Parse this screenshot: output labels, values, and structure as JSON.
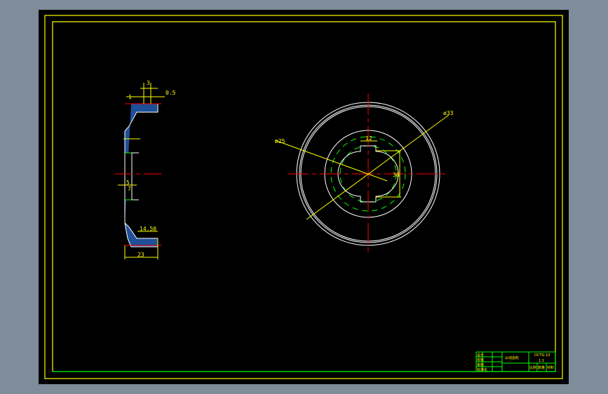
{
  "drawing": {
    "side_view_dims": {
      "top": "3",
      "top_left": "1",
      "top_right": "0.5",
      "mid": "5",
      "mid2": "7",
      "width_inner": "14.50",
      "width_total": "23"
    },
    "front_view_dims": {
      "dia_left": "ø25",
      "dia_right": "ø33",
      "key_width": "12",
      "key_height": "38"
    },
    "title_block": {
      "c1": "设计",
      "c2": "校核",
      "c3": "审核",
      "c4": "标准化",
      "name": "从动齿轮",
      "code": "DCTG-10",
      "scale_label": "比例",
      "qty_label": "数量",
      "mat_label": "材料",
      "unit": "1:1"
    }
  },
  "colors": {
    "bg": "#7f8c9a",
    "sheet": "#000000",
    "frame": "#ffff00",
    "line": "#ffffff",
    "center": "#ff0000",
    "hidden": "#00ff00",
    "hatch": "#3a7ad8"
  }
}
